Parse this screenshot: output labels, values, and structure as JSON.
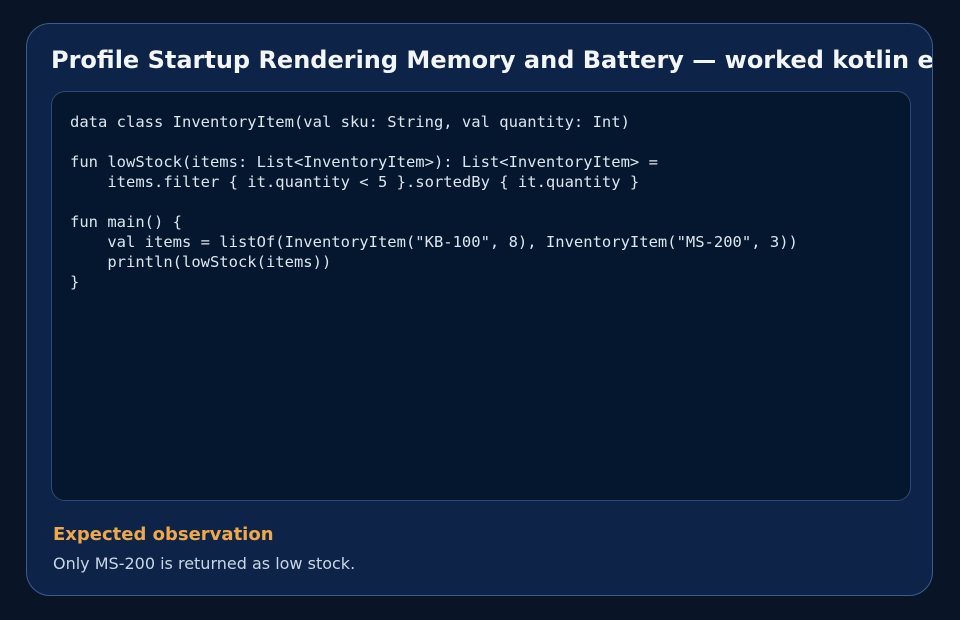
{
  "card": {
    "title": "Profile Startup Rendering Memory and Battery — worked kotlin example"
  },
  "code": {
    "language": "kotlin",
    "lines": [
      "data class InventoryItem(val sku: String, val quantity: Int)",
      "",
      "fun lowStock(items: List<InventoryItem>): List<InventoryItem> =",
      "    items.filter { it.quantity < 5 }.sortedBy { it.quantity }",
      "",
      "fun main() {",
      "    val items = listOf(InventoryItem(\"KB-100\", 8), InventoryItem(\"MS-200\", 3))",
      "    println(lowStock(items))",
      "}"
    ]
  },
  "observation": {
    "heading": "Expected observation",
    "text": "Only MS-200 is returned as low stock."
  },
  "colors": {
    "background": "#0a1427",
    "card": "#0d2448",
    "code_panel": "#04172e",
    "accent": "#f0a94a",
    "title": "#f2f5fa"
  }
}
